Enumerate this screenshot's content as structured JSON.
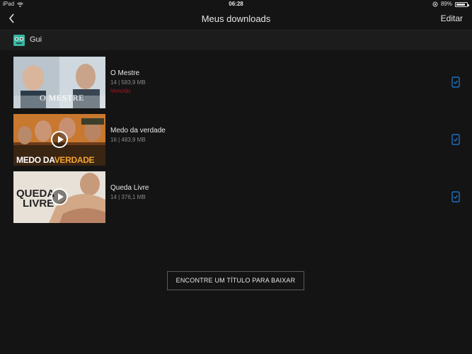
{
  "status_bar": {
    "device": "iPad",
    "time": "06:28",
    "battery": "89%",
    "battery_level": 0.89
  },
  "nav": {
    "title": "Meus downloads",
    "edit_label": "Editar",
    "back_icon": "chevron-left-icon"
  },
  "profile": {
    "name": "Gui",
    "avatar_color": "#3bb6a3"
  },
  "downloads": [
    {
      "title": "O Mestre",
      "meta": "14 | 583,9 MB",
      "status": "Vencido",
      "thumb_text": "O MESTRE",
      "has_play": false
    },
    {
      "title": "Medo da verdade",
      "meta": "16 | 483,9 MB",
      "status": "",
      "thumb_text_1": "MEDO DA",
      "thumb_text_2": "VERDADE",
      "has_play": true
    },
    {
      "title": "Queda Livre",
      "meta": "14 | 376,1 MB",
      "status": "",
      "thumb_text_1": "QUEDA",
      "thumb_text_2": "LIVRE",
      "has_play": true
    }
  ],
  "find_button_label": "ENCONTRE UM TÍTULO PARA BAIXAR",
  "colors": {
    "background": "#141414",
    "accent_blue": "#1f7fe0",
    "expired_red": "#b3121d"
  }
}
